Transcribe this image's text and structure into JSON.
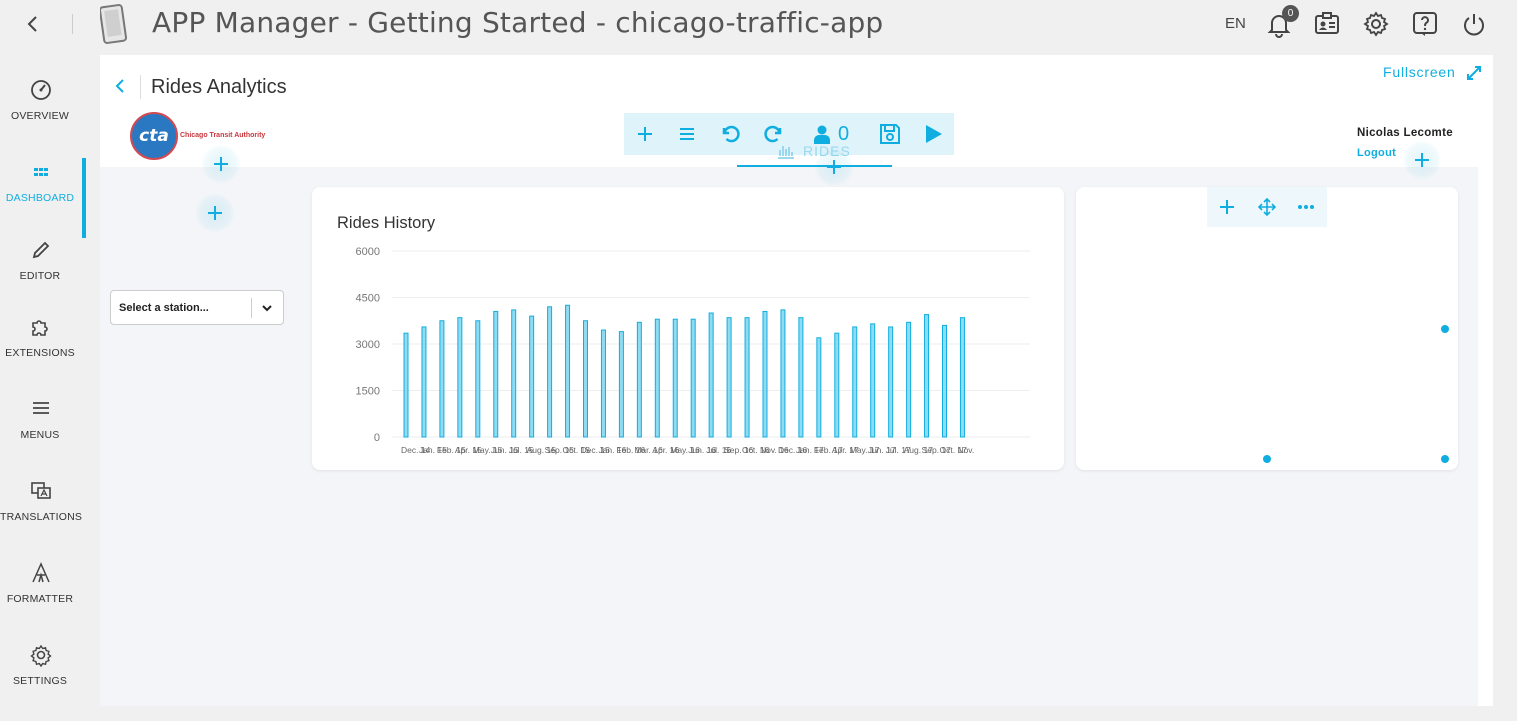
{
  "topbar": {
    "title": "APP Manager - Getting Started - chicago-traffic-app",
    "language": "EN",
    "notification_count": "0"
  },
  "sidebar": {
    "items": [
      {
        "label": "OVERVIEW",
        "icon": "gauge-icon"
      },
      {
        "label": "DASHBOARD",
        "icon": "grid-icon",
        "active": true
      },
      {
        "label": "EDITOR",
        "icon": "pencil-icon"
      },
      {
        "label": "EXTENSIONS",
        "icon": "puzzle-icon"
      },
      {
        "label": "MENUS",
        "icon": "hamburger-icon"
      },
      {
        "label": "TRANSLATIONS",
        "icon": "translate-icon"
      },
      {
        "label": "FORMATTER",
        "icon": "formatter-icon"
      },
      {
        "label": "SETTINGS",
        "icon": "gear-icon"
      }
    ]
  },
  "page": {
    "title": "Rides Analytics",
    "fullscreen_label": "Fullscreen"
  },
  "header": {
    "logo_text": "Chicago Transit Authority",
    "logo_mark": "cta",
    "user_name": "Nicolas Lecomte",
    "logout_label": "Logout"
  },
  "toolbar": {
    "user_count": "0"
  },
  "tabs": [
    {
      "label": "RIDES",
      "active": true
    }
  ],
  "station_select": {
    "placeholder": "Select a station..."
  },
  "colors": {
    "accent": "#10aee0",
    "logo_red": "#c8383f",
    "logo_blue": "#2b78c2"
  },
  "chart_data": {
    "type": "bar",
    "title": "Rides History",
    "xlabel": "",
    "ylabel": "",
    "ylim": [
      0,
      6000
    ],
    "yticks": [
      "0",
      "1500",
      "3000",
      "4500",
      "6000"
    ],
    "grid": true,
    "tick_labels": [
      "Dec. 14",
      "Jan. 15",
      "Feb. 15",
      "Apr. 15",
      "May. 15",
      "Jun. 15",
      "Jul. 15",
      "Aug. 15",
      "Sep. 15",
      "Oct. 15",
      "Dec. 15",
      "Jan. 16",
      "Feb. 16",
      "Mar. 16",
      "Apr. 16",
      "May. 16",
      "Jun. 16",
      "Jul. 16",
      "Sep. 16",
      "Oct. 16",
      "Nov. 16",
      "Dec. 16",
      "Jan. 17",
      "Feb. 17",
      "Apr. 17",
      "May. 17",
      "Jun. 17",
      "Jul. 17",
      "Aug. 17",
      "Sep. 17",
      "Oct. 17",
      "Nov."
    ],
    "values": [
      3350,
      3550,
      3750,
      3850,
      3750,
      4050,
      4100,
      3900,
      4200,
      4250,
      3750,
      3450,
      3400,
      3700,
      3800,
      3800,
      3800,
      4000,
      3850,
      3850,
      4050,
      4100,
      3850,
      3200,
      3350,
      3550,
      3650,
      3550,
      3700,
      3950,
      3600,
      3850
    ]
  }
}
